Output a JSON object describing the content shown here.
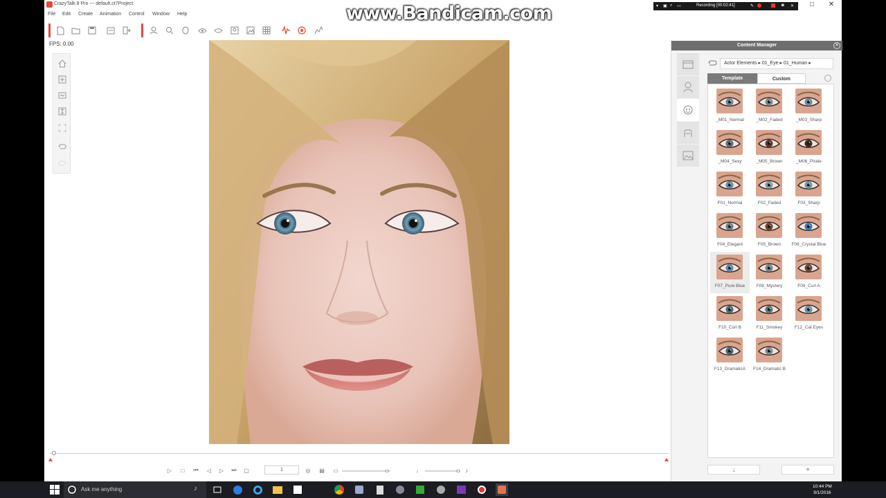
{
  "window": {
    "title": "CrazyTalk 8 Pro --- default.ct7Project",
    "minimize": "─",
    "maximize": "□",
    "close": "✕"
  },
  "watermark": "www.Bandicam.com",
  "recording": {
    "label": "Recording [00:02:41]"
  },
  "menu": [
    "File",
    "Edit",
    "Create",
    "Animation",
    "Control",
    "Window",
    "Help"
  ],
  "fps_label": "FPS: 0.00",
  "playback": {
    "frame_value": "1"
  },
  "content_manager": {
    "title": "Content Manager",
    "breadcrumb": "Actor Elements ▸  01_Eye ▸  01_Human ▸",
    "tabs": {
      "template": "Template",
      "custom": "Custom"
    },
    "items": [
      {
        "label": "_M01_Normal",
        "iris": "#6d8896"
      },
      {
        "label": "_M02_Faded",
        "iris": "#7d8a92"
      },
      {
        "label": "_M03_Sharp",
        "iris": "#6a8da3"
      },
      {
        "label": "_M04_Sexy",
        "iris": "#5f6e78"
      },
      {
        "label": "_M05_Brown",
        "iris": "#5a3a28"
      },
      {
        "label": "_M06_Pirate",
        "iris": "#3b2c26"
      },
      {
        "label": "F01_Normal",
        "iris": "#5e8ea0"
      },
      {
        "label": "F02_Faded",
        "iris": "#7e9aa5"
      },
      {
        "label": "F03_Sharp",
        "iris": "#6b98aa"
      },
      {
        "label": "F04_Elegant",
        "iris": "#6d7d86"
      },
      {
        "label": "F05_Brown",
        "iris": "#6b4330"
      },
      {
        "label": "F06_Crystal Blue",
        "iris": "#3f78b8"
      },
      {
        "label": "F07_Pure Blue",
        "iris": "#5a8db0",
        "selected": true
      },
      {
        "label": "F08_Mystery",
        "iris": "#6f8792"
      },
      {
        "label": "F09_Curl A",
        "iris": "#6a4a3a"
      },
      {
        "label": "F10_Curl B",
        "iris": "#4f6b7a"
      },
      {
        "label": "F11_Smokey",
        "iris": "#5f7582"
      },
      {
        "label": "F12_Cat Eyes",
        "iris": "#6993a6"
      },
      {
        "label": "F13_DramaticA",
        "iris": "#4e6676"
      },
      {
        "label": "F14_Dramatic B",
        "iris": "#7a8b94"
      }
    ],
    "bottom_left_icon": "↓",
    "bottom_right_icon": "+"
  },
  "taskbar": {
    "search_placeholder": "Ask me anything",
    "time": "10:44 PM",
    "date": "9/1/2016"
  },
  "colors": {
    "accent_red": "#e8473b",
    "panel_header": "#6e6e6e"
  }
}
